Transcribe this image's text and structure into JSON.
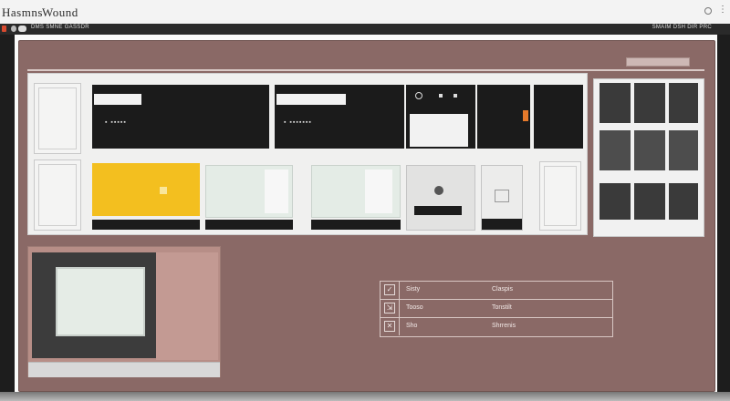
{
  "titlebar": {
    "left_title": "Hasmns",
    "right_title": "Wound",
    "icons": [
      "pin-icon",
      "menu-dot-icon"
    ]
  },
  "strip": {
    "left_text": "DMS  SMNE  GASSDR",
    "right_text": "SMAIM  DSH  DIR  PRC",
    "icons": [
      "app-icon",
      "toggle-icon"
    ]
  },
  "modules": {
    "top_row_dots": [
      "▪ ▪▪▪▪▪",
      "▪ ▪▪▪▪▪▪▪"
    ],
    "accent_colors": {
      "panel": "#8a6966",
      "yellow": "#f3bf1f",
      "mint": "#e4ece6",
      "black": "#1b1b1b"
    }
  },
  "table": {
    "rows": [
      {
        "icon": "check-icon",
        "label": "Sisty",
        "value": "Claspis"
      },
      {
        "icon": "expand-icon",
        "label": "Tooso",
        "value": "Tonstilt"
      },
      {
        "icon": "close-icon",
        "label": "Sho",
        "value": "Shrrenis"
      }
    ]
  }
}
